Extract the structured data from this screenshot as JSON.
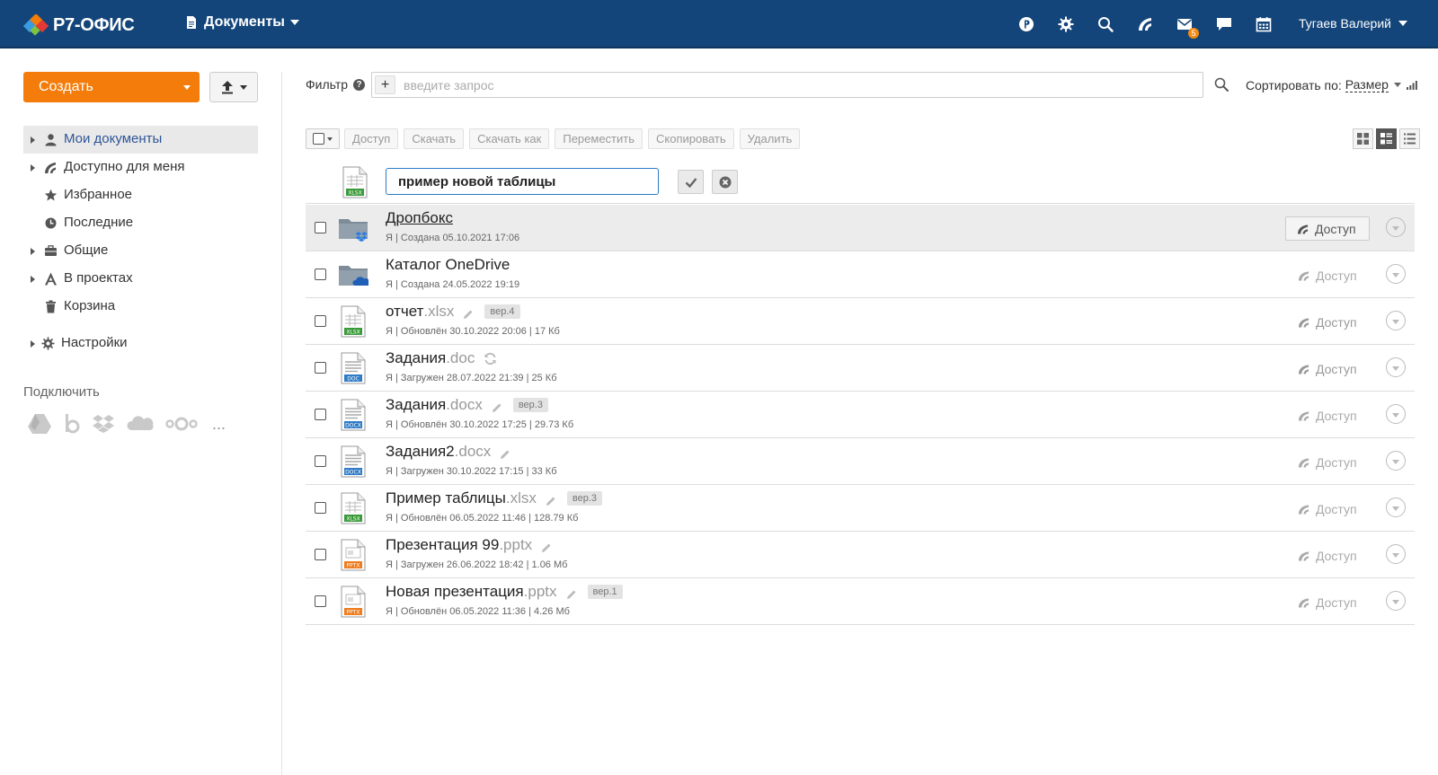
{
  "header": {
    "logo_text": "Р7-ОФИС",
    "module_label": "Документы",
    "mail_badge": "5",
    "user_name": "Тугаев Валерий",
    "colors": {
      "bar": "#13457a",
      "accent": "#f37c0a"
    }
  },
  "sidebar": {
    "create_label": "Создать",
    "items": [
      {
        "label": "Мои документы",
        "icon": "user-icon",
        "active": true,
        "expandable": true
      },
      {
        "label": "Доступно для меня",
        "icon": "share-icon",
        "expandable": true
      },
      {
        "label": "Избранное",
        "icon": "star-icon"
      },
      {
        "label": "Последние",
        "icon": "clock-icon"
      },
      {
        "label": "Общие",
        "icon": "briefcase-icon",
        "expandable": true
      },
      {
        "label": "В проектах",
        "icon": "projects-icon",
        "expandable": true
      },
      {
        "label": "Корзина",
        "icon": "trash-icon"
      }
    ],
    "settings_label": "Настройки",
    "connect_label": "Подключить",
    "connect_services": [
      "google-drive-icon",
      "box-icon",
      "dropbox-icon",
      "onedrive-icon",
      "nextcloud-icon"
    ],
    "connect_more": "..."
  },
  "filter": {
    "label": "Фильтр",
    "help": "?",
    "plus": "+",
    "placeholder": "введите запрос",
    "sort_label": "Сортировать по:",
    "sort_value": "Размер"
  },
  "toolbar": {
    "buttons": [
      "Доступ",
      "Скачать",
      "Скачать как",
      "Переместить",
      "Скопировать",
      "Удалить"
    ]
  },
  "new_file": {
    "value": "пример новой таблицы",
    "type": "xlsx"
  },
  "files": [
    {
      "name": "Дропбокс",
      "ext": "",
      "type": "folder-dropbox",
      "meta": "Я | Создана 05.10.2021 17:06",
      "share_label": "Доступ",
      "hover": true
    },
    {
      "name": "Каталог OneDrive",
      "ext": "",
      "type": "folder-onedrive",
      "meta": "Я | Создана 24.05.2022 19:19",
      "share_label": "Доступ"
    },
    {
      "name": "отчет",
      "ext": ".xlsx",
      "type": "xlsx",
      "meta": "Я | Обновлён 30.10.2022 20:06 | 17 Кб",
      "share_label": "Доступ",
      "pencil": true,
      "version": "вер.4",
      "shared": true
    },
    {
      "name": "Задания",
      "ext": ".doc",
      "type": "doc",
      "meta": "Я | Загружен 28.07.2022 21:39 | 25 Кб",
      "share_label": "Доступ",
      "sync": true,
      "shared": true
    },
    {
      "name": "Задания",
      "ext": ".docx",
      "type": "docx",
      "meta": "Я | Обновлён 30.10.2022 17:25 | 29.73 Кб",
      "share_label": "Доступ",
      "pencil": true,
      "version": "вер.3"
    },
    {
      "name": "Задания2",
      "ext": ".docx",
      "type": "docx",
      "meta": "Я | Загружен 30.10.2022 17:15 | 33 Кб",
      "share_label": "Доступ",
      "pencil": true
    },
    {
      "name": "Пример таблицы",
      "ext": ".xlsx",
      "type": "xlsx",
      "meta": "Я | Обновлён 06.05.2022 11:46 | 128.79 Кб",
      "share_label": "Доступ",
      "pencil": true,
      "version": "вер.3"
    },
    {
      "name": "Презентация 99",
      "ext": ".pptx",
      "type": "pptx",
      "meta": "Я | Загружен 26.06.2022 18:42 | 1.06 Мб",
      "share_label": "Доступ",
      "pencil": true
    },
    {
      "name": "Новая презентация",
      "ext": ".pptx",
      "type": "pptx",
      "meta": "Я | Обновлён 06.05.2022 11:36 | 4.26 Мб",
      "share_label": "Доступ",
      "pencil": true,
      "version": "вер.1"
    }
  ]
}
